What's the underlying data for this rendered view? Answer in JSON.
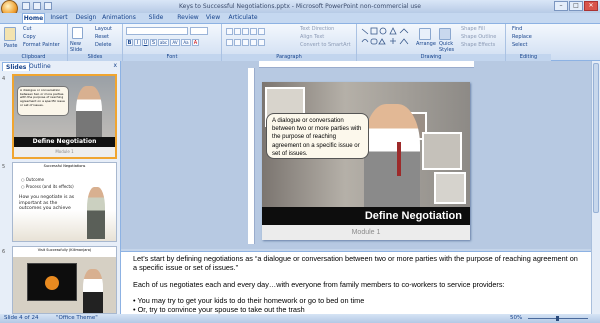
{
  "window": {
    "title": "Keys to Successful Negotiations.pptx - Microsoft PowerPoint non-commercial use"
  },
  "tabs": [
    "Home",
    "Insert",
    "Design",
    "Animations",
    "Slide Show",
    "Review",
    "View",
    "Articulate"
  ],
  "ribbon": {
    "clipboard": {
      "label": "Clipboard",
      "paste": "Paste",
      "cut": "Cut",
      "copy": "Copy",
      "format_painter": "Format Painter"
    },
    "slides": {
      "label": "Slides",
      "new_slide": "New Slide",
      "layout": "Layout",
      "reset": "Reset",
      "delete": "Delete"
    },
    "font": {
      "label": "Font",
      "buttons": [
        "B",
        "I",
        "U",
        "S",
        "abc",
        "AV",
        "Aa",
        "A"
      ]
    },
    "paragraph": {
      "label": "Paragraph",
      "text_direction": "Text Direction",
      "align_text": "Align Text",
      "convert": "Convert to SmartArt"
    },
    "drawing": {
      "label": "Drawing",
      "arrange": "Arrange",
      "quick_styles": "Quick Styles",
      "shape_fill": "Shape Fill",
      "shape_outline": "Shape Outline",
      "shape_effects": "Shape Effects"
    },
    "editing": {
      "label": "Editing",
      "find": "Find",
      "replace": "Replace",
      "select": "Select"
    }
  },
  "panel": {
    "tab_slides": "Slides",
    "tab_outline": "Outline",
    "close": "x"
  },
  "thumbs": [
    {
      "num": "4",
      "title": "Define Negotiation",
      "sub": "Module 1",
      "callout": "A dialogue or conversation between two or more parties with the purpose of reaching agreement on a specific issue or set of issues."
    },
    {
      "num": "5",
      "title": "Successful Negotiations",
      "bullets": [
        "Outcome",
        "Process (and its effects)"
      ],
      "body": "How you negotiate is as important as the outcomes you achieve"
    },
    {
      "num": "6",
      "title": "Visit Successfully (Kilimanjaro)"
    }
  ],
  "slide": {
    "callout": "A dialogue or conversation between two or more parties with the purpose of reaching agreement on a specific issue or set of issues.",
    "title": "Define Negotiation",
    "subtitle": "Module 1"
  },
  "notes": {
    "p1": "Let’s start by defining negotiations as “a dialogue or conversation between two or more parties with the purpose of reaching agreement on a specific issue or set of issues.”",
    "p2": "Each of us negotiates each and every day…with everyone from family members to co-workers to service providers:",
    "b1": "• You may try to get your kids to do their homework or go to bed on time",
    "b2": "• Or, try to convince your spouse to take out the trash"
  },
  "status": {
    "slide": "Slide 4 of 24",
    "theme": "\"Office Theme\"",
    "zoom": "50%"
  }
}
